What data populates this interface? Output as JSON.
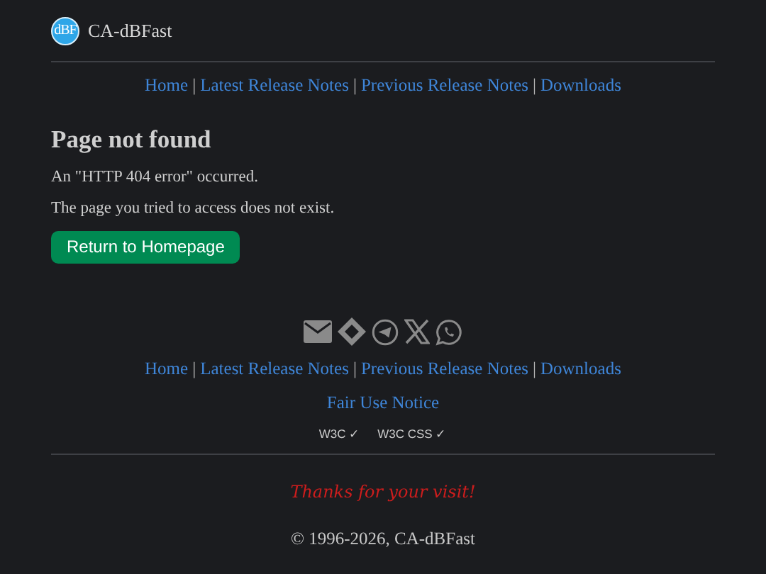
{
  "header": {
    "logo_text": "dBF",
    "site_name": "CA-dBFast"
  },
  "top_nav": {
    "separator": "|",
    "links": [
      "Home",
      "Latest Release Notes",
      "Previous Release Notes",
      "Downloads"
    ]
  },
  "main": {
    "title": "Page not found",
    "paragraphs": [
      "An \"HTTP 404 error\" occurred.",
      "The page you tried to access does not exist."
    ],
    "button": "Return to Homepage"
  },
  "footer": {
    "nav": {
      "separator": "|",
      "links": [
        "Home",
        "Latest Release Notes",
        "Previous Release Notes",
        "Downloads"
      ]
    },
    "notice_link": "Fair Use Notice",
    "badges": [
      "W3C ✓",
      "W3C CSS ✓"
    ],
    "thanks": "Thanks for your visit!",
    "copyright": "© 1996-2026, CA-dBFast"
  }
}
